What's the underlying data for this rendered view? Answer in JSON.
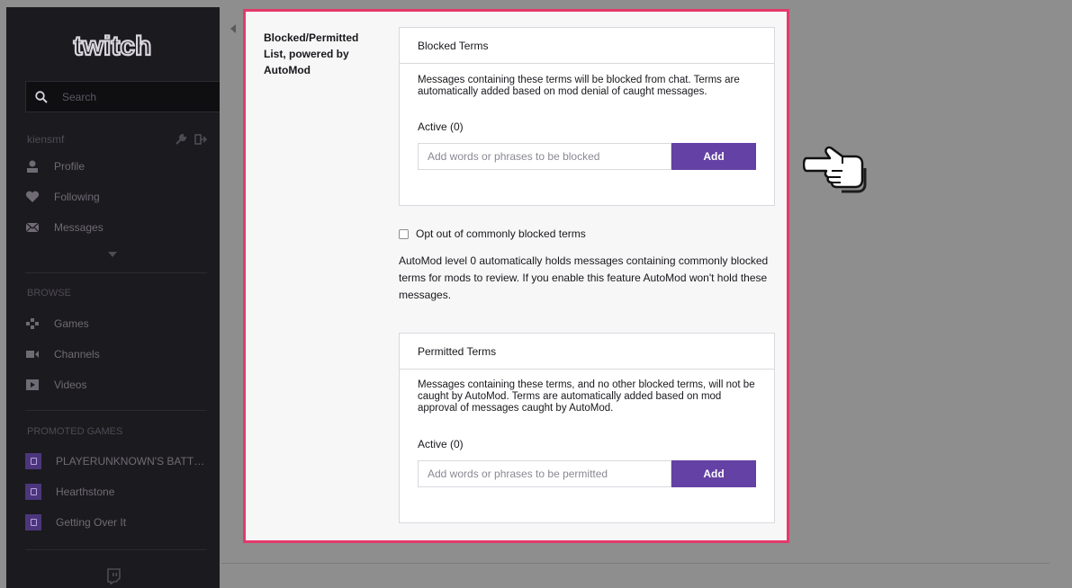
{
  "sidebar": {
    "logo_text": "twitch",
    "search_placeholder": "Search",
    "username": "kiensmf",
    "nav": [
      {
        "label": "Profile",
        "icon": "person-icon"
      },
      {
        "label": "Following",
        "icon": "heart-icon"
      },
      {
        "label": "Messages",
        "icon": "envelope-icon"
      }
    ],
    "browse_label": "BROWSE",
    "browse": [
      {
        "label": "Games",
        "icon": "gamepad-icon"
      },
      {
        "label": "Channels",
        "icon": "camera-icon"
      },
      {
        "label": "Videos",
        "icon": "play-icon"
      }
    ],
    "promoted_label": "PROMOTED GAMES",
    "promoted": [
      {
        "label": "PLAYERUNKNOWN'S BATT…"
      },
      {
        "label": "Hearthstone"
      },
      {
        "label": "Getting Over It"
      }
    ]
  },
  "panel": {
    "label": "Blocked/Permitted List, powered by AutoMod",
    "blocked": {
      "title": "Blocked Terms",
      "description": "Messages containing these terms will be blocked from chat. Terms are automatically added based on mod denial of caught messages.",
      "active": "Active (0)",
      "placeholder": "Add words or phrases to be blocked",
      "button": "Add"
    },
    "optout_label": "Opt out of commonly blocked terms",
    "automod_text": "AutoMod level 0 automatically holds messages containing commonly blocked terms for mods to review. If you enable this feature AutoMod won't hold these messages.",
    "permitted": {
      "title": "Permitted Terms",
      "description": "Messages containing these terms, and no other blocked terms, will not be caught by AutoMod. Terms are automatically added based on mod approval of messages caught by AutoMod.",
      "active": "Active (0)",
      "placeholder": "Add words or phrases to be permitted",
      "button": "Add"
    }
  },
  "colors": {
    "accent": "#6441a4",
    "highlight_border": "#e33a6c",
    "sidebar_bg": "#1b1a1e"
  }
}
